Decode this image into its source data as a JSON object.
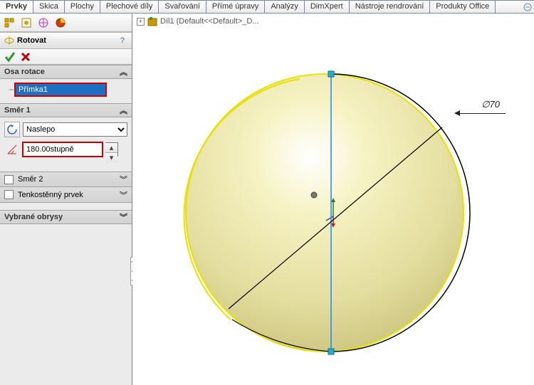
{
  "tabs": {
    "items": [
      "Prvky",
      "Skica",
      "Plochy",
      "Plechové díly",
      "Svařování",
      "Přímé úpravy",
      "Analýzy",
      "DimXpert",
      "Nástroje rendrování",
      "Produkty Office"
    ],
    "active_index": 0
  },
  "feature": {
    "title": "Rotovat",
    "help": "?"
  },
  "sections": {
    "axis": {
      "header": "Osa rotace",
      "value": "Přímka1"
    },
    "dir1": {
      "header": "Směr 1",
      "mode": "Naslepo",
      "angle": "180.00stupně"
    },
    "dir2": {
      "header": "Směr 2"
    },
    "thin": {
      "header": "Tenkostěnný prvek"
    },
    "contours": {
      "header": "Vybrané obrysy"
    }
  },
  "tree": {
    "label": "Díl1  (Default<<Default>_D..."
  },
  "viewport": {
    "dimension_label": "∅70"
  },
  "colors": {
    "accent": "#1f6fc2",
    "error": "#c00"
  }
}
